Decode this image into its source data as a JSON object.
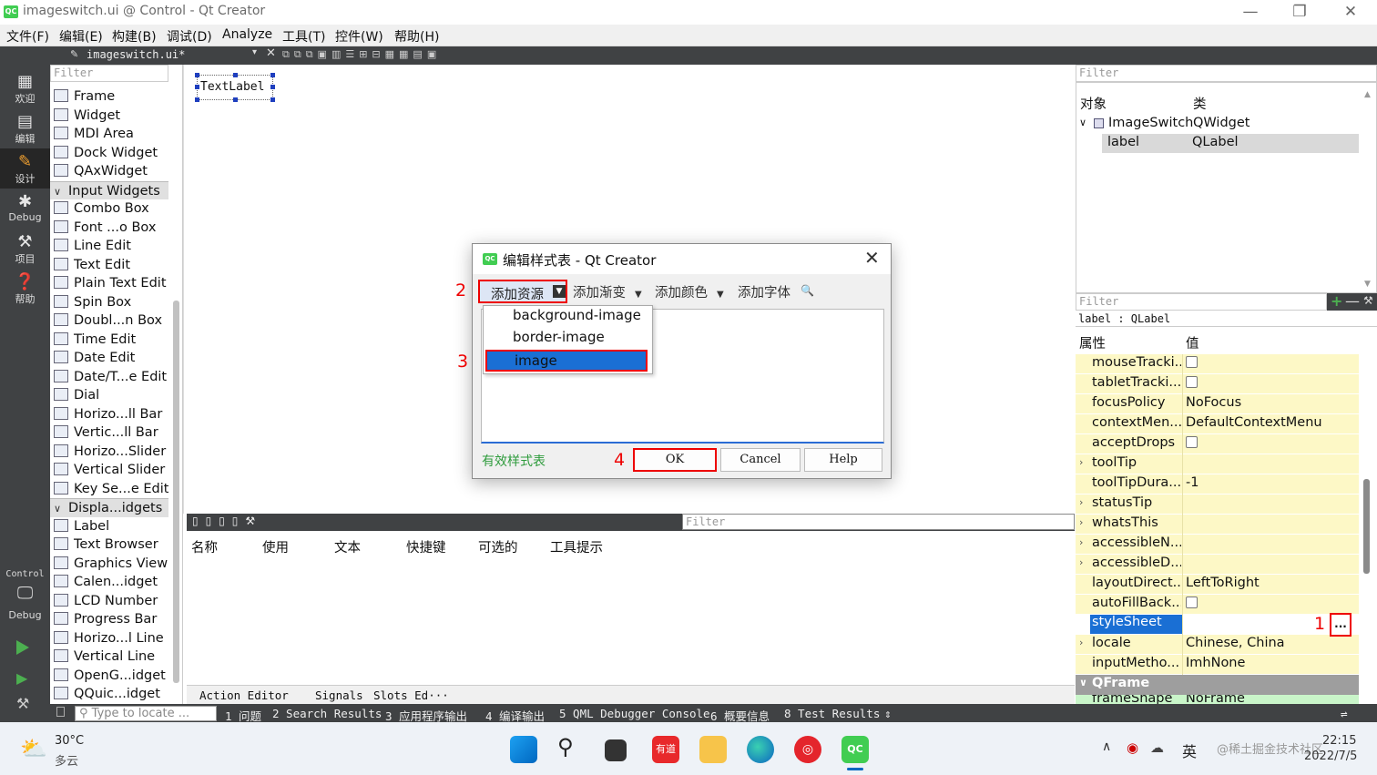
{
  "window": {
    "title": "imageswitch.ui @ Control - Qt Creator",
    "minimize": "—",
    "restore": "❐",
    "close": "✕"
  },
  "menu": [
    "文件(F)",
    "编辑(E)",
    "构建(B)",
    "调试(D)",
    "Analyze",
    "工具(T)",
    "控件(W)",
    "帮助(H)"
  ],
  "modes": [
    {
      "label": "欢迎",
      "icon": "grid-icon"
    },
    {
      "label": "编辑",
      "icon": "document-icon"
    },
    {
      "label": "设计",
      "icon": "pencil-icon"
    },
    {
      "label": "Debug",
      "icon": "bug-icon"
    },
    {
      "label": "项目",
      "icon": "wrench-icon"
    },
    {
      "label": "帮助",
      "icon": "help-icon"
    }
  ],
  "kit": {
    "project": "Control",
    "config": "Debug"
  },
  "editor_tab": {
    "file": "imageswitch.ui*"
  },
  "widget_box": {
    "filter_placeholder": "Filter",
    "items": [
      {
        "label": "Frame",
        "type": "item"
      },
      {
        "label": "Widget",
        "type": "item"
      },
      {
        "label": "MDI Area",
        "type": "item"
      },
      {
        "label": "Dock Widget",
        "type": "item"
      },
      {
        "label": "QAxWidget",
        "type": "item"
      },
      {
        "label": "Input Widgets",
        "type": "category"
      },
      {
        "label": "Combo Box",
        "type": "item"
      },
      {
        "label": "Font ...o Box",
        "type": "item"
      },
      {
        "label": "Line Edit",
        "type": "item"
      },
      {
        "label": "Text Edit",
        "type": "item"
      },
      {
        "label": "Plain Text Edit",
        "type": "item"
      },
      {
        "label": "Spin Box",
        "type": "item"
      },
      {
        "label": "Doubl...n Box",
        "type": "item"
      },
      {
        "label": "Time Edit",
        "type": "item"
      },
      {
        "label": "Date Edit",
        "type": "item"
      },
      {
        "label": "Date/T...e Edit",
        "type": "item"
      },
      {
        "label": "Dial",
        "type": "item"
      },
      {
        "label": "Horizo...ll Bar",
        "type": "item"
      },
      {
        "label": "Vertic...ll Bar",
        "type": "item"
      },
      {
        "label": "Horizo...Slider",
        "type": "item"
      },
      {
        "label": "Vertical Slider",
        "type": "item"
      },
      {
        "label": "Key Se...e Edit",
        "type": "item"
      },
      {
        "label": "Displa...idgets",
        "type": "category"
      },
      {
        "label": "Label",
        "type": "item"
      },
      {
        "label": "Text Browser",
        "type": "item"
      },
      {
        "label": "Graphics View",
        "type": "item"
      },
      {
        "label": "Calen...idget",
        "type": "item"
      },
      {
        "label": "LCD Number",
        "type": "item"
      },
      {
        "label": "Progress Bar",
        "type": "item"
      },
      {
        "label": "Horizo...l Line",
        "type": "item"
      },
      {
        "label": "Vertical Line",
        "type": "item"
      },
      {
        "label": "OpenG...idget",
        "type": "item"
      },
      {
        "label": "QQuic...idget",
        "type": "item"
      }
    ]
  },
  "canvas": {
    "text_label": "TextLabel"
  },
  "action_editor": {
    "filter_placeholder": "Filter",
    "columns": [
      "名称",
      "使用",
      "文本",
      "快捷键",
      "可选的",
      "工具提示"
    ],
    "tabs": [
      "Action Editor",
      "Signals",
      "Slots Ed···"
    ]
  },
  "object_inspector": {
    "filter_placeholder": "Filter",
    "headers": [
      "对象",
      "类"
    ],
    "rows": [
      {
        "object": "ImageSwitch",
        "class": "QWidget"
      },
      {
        "object": "label",
        "class": "QLabel"
      }
    ]
  },
  "property_editor": {
    "filter_placeholder": "Filter",
    "object": "label : QLabel",
    "headers": [
      "属性",
      "值"
    ],
    "rows": [
      {
        "name": "mouseTracki...",
        "value": "",
        "checkbox": true,
        "expand": false
      },
      {
        "name": "tabletTracki...",
        "value": "",
        "checkbox": true,
        "expand": false
      },
      {
        "name": "focusPolicy",
        "value": "NoFocus",
        "checkbox": false,
        "expand": false
      },
      {
        "name": "contextMen...",
        "value": "DefaultContextMenu",
        "checkbox": false,
        "expand": false
      },
      {
        "name": "acceptDrops",
        "value": "",
        "checkbox": true,
        "expand": false
      },
      {
        "name": "toolTip",
        "value": "",
        "checkbox": false,
        "expand": true
      },
      {
        "name": "toolTipDura...",
        "value": "-1",
        "checkbox": false,
        "expand": false
      },
      {
        "name": "statusTip",
        "value": "",
        "checkbox": false,
        "expand": true
      },
      {
        "name": "whatsThis",
        "value": "",
        "checkbox": false,
        "expand": true
      },
      {
        "name": "accessibleN...",
        "value": "",
        "checkbox": false,
        "expand": true
      },
      {
        "name": "accessibleD...",
        "value": "",
        "checkbox": false,
        "expand": true
      },
      {
        "name": "layoutDirect...",
        "value": "LeftToRight",
        "checkbox": false,
        "expand": false
      },
      {
        "name": "autoFillBack...",
        "value": "",
        "checkbox": true,
        "expand": false
      },
      {
        "name": "styleSheet",
        "value": "",
        "checkbox": false,
        "expand": false,
        "selected": true
      },
      {
        "name": "locale",
        "value": "Chinese, China",
        "checkbox": false,
        "expand": true
      },
      {
        "name": "inputMetho...",
        "value": "ImhNone",
        "checkbox": false,
        "expand": false
      }
    ],
    "section": "QFrame",
    "partial_row": {
      "name": "frameShape",
      "value": "NoFrame"
    },
    "ellipsis_button": "..."
  },
  "annotations": [
    "1",
    "2",
    "3",
    "4"
  ],
  "dialog": {
    "title": "编辑样式表 - Qt Creator",
    "close": "✕",
    "toolbar": {
      "add_resource": "添加资源",
      "add_gradient": "添加渐变",
      "add_color": "添加颜色",
      "add_font": "添加字体"
    },
    "popup": [
      "background-image",
      "border-image",
      "image"
    ],
    "valid": "有效样式表",
    "buttons": {
      "ok": "OK",
      "cancel": "Cancel",
      "help": "Help"
    }
  },
  "status": {
    "locate_placeholder": "Type to locate ...",
    "tabs": [
      "1 问题",
      "2 Search Results",
      "3 应用程序输出",
      "4 编译输出",
      "5 QML Debugger Console",
      "6 概要信息",
      "8 Test Results"
    ]
  },
  "taskbar": {
    "weather_temp": "30°C",
    "weather_desc": "多云",
    "ime": "英",
    "time": "22:15",
    "date": "2022/7/5",
    "watermark": "@稀土掘金技术社区"
  },
  "colors": {
    "accent": "#1a6fd4",
    "annotation": "#e00000",
    "dark_panel": "#404244",
    "property_row": "#fdf8c6",
    "qt_green": "#41cd52"
  }
}
